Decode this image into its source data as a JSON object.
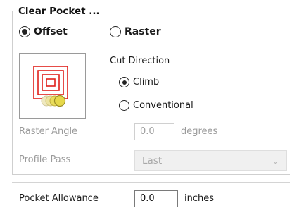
{
  "group": {
    "title": "Clear Pocket ..."
  },
  "strategy": {
    "offset_label": "Offset",
    "raster_label": "Raster",
    "selected": "Offset"
  },
  "cut_direction": {
    "title": "Cut Direction",
    "climb_label": "Climb",
    "conventional_label": "Conventional",
    "selected": "Climb"
  },
  "raster_angle": {
    "label": "Raster Angle",
    "value": "0.0",
    "unit": "degrees"
  },
  "profile_pass": {
    "label": "Profile Pass",
    "value": "Last"
  },
  "pocket_allowance": {
    "label": "Pocket Allowance",
    "value": "0.0",
    "unit": "inches"
  },
  "icons": {
    "toolpath_preview": "pocket-offset-icon",
    "dropdown": "chevron-down-icon"
  },
  "colors": {
    "toolpath_red": "#e0201b",
    "tool_yellow": "#e9dc5b",
    "disabled_text": "#9b9b9b"
  }
}
